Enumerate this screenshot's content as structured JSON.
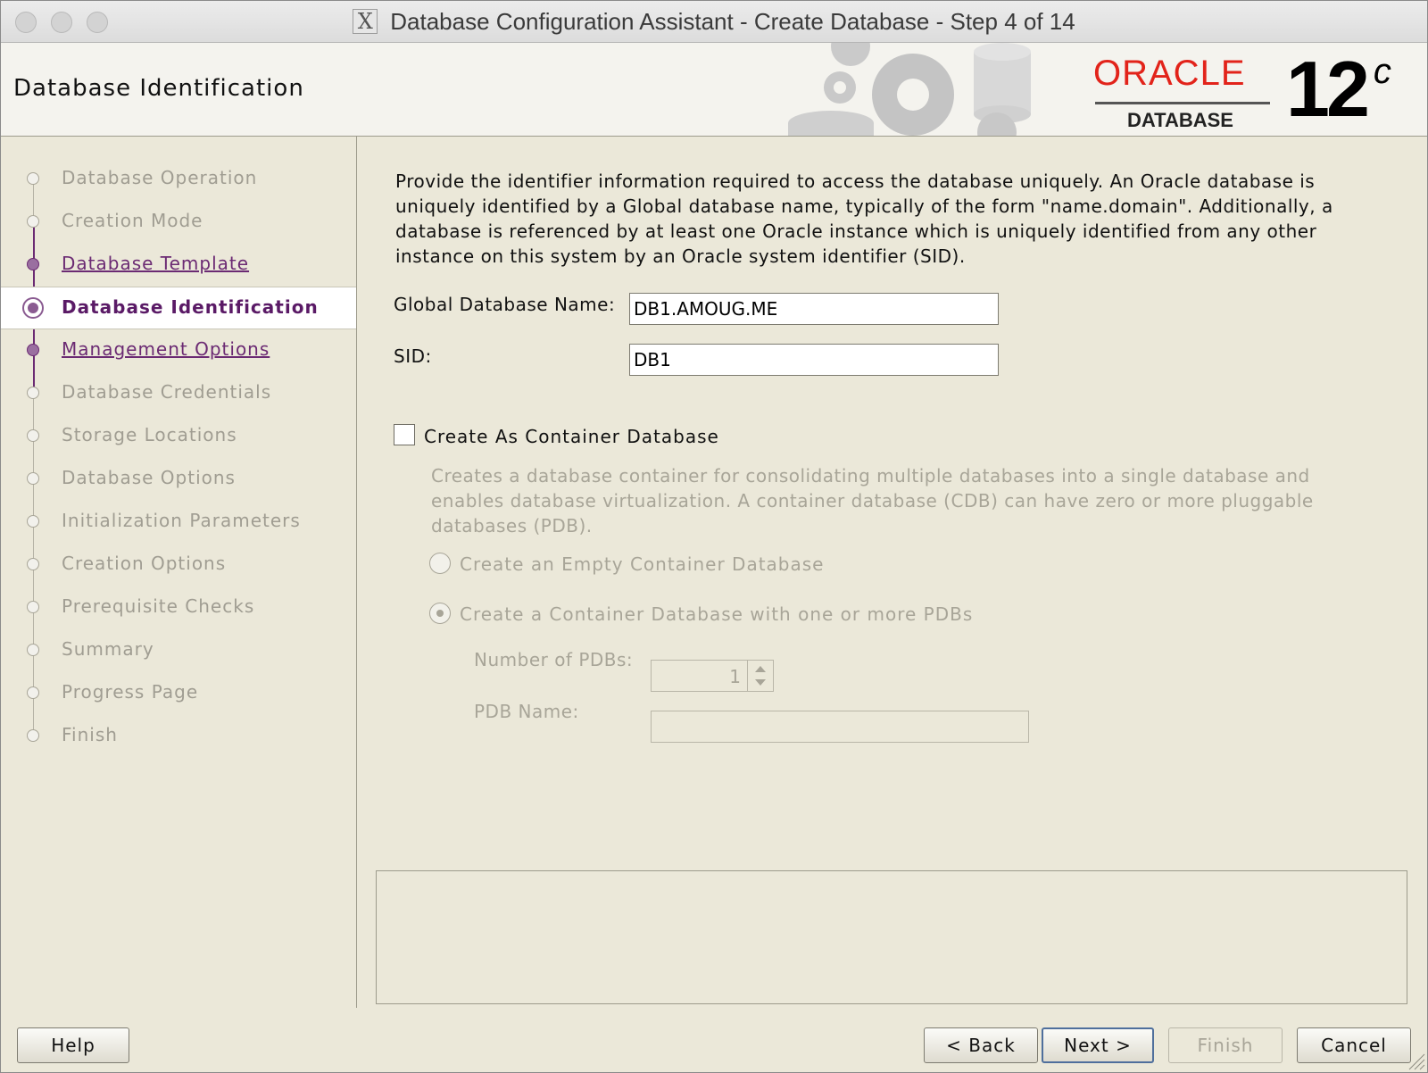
{
  "window": {
    "title": "Database Configuration Assistant - Create Database - Step 4 of 14",
    "title_icon": "X"
  },
  "banner": {
    "title": "Database Identification",
    "logo_word": "ORACLE",
    "logo_sub": "DATABASE",
    "version": "12",
    "version_sup": "c",
    "logo_color": "#e2231a"
  },
  "nav": {
    "items": [
      {
        "label": "Database Operation",
        "state": "done"
      },
      {
        "label": "Creation Mode",
        "state": "done"
      },
      {
        "label": "Database Template",
        "state": "link"
      },
      {
        "label": "Database Identification",
        "state": "current"
      },
      {
        "label": "Management Options",
        "state": "link"
      },
      {
        "label": "Database Credentials",
        "state": "pending"
      },
      {
        "label": "Storage Locations",
        "state": "pending"
      },
      {
        "label": "Database Options",
        "state": "pending"
      },
      {
        "label": "Initialization Parameters",
        "state": "pending"
      },
      {
        "label": "Creation Options",
        "state": "pending"
      },
      {
        "label": "Prerequisite Checks",
        "state": "pending"
      },
      {
        "label": "Summary",
        "state": "pending"
      },
      {
        "label": "Progress Page",
        "state": "pending"
      },
      {
        "label": "Finish",
        "state": "pending"
      }
    ]
  },
  "main": {
    "intro": "Provide the identifier information required to access the database uniquely. An Oracle database is uniquely identified by a Global database name, typically of the form \"name.domain\". Additionally, a database is referenced by at least one Oracle instance which is uniquely identified from any other instance on this system by an Oracle system identifier (SID).",
    "global_name_label": "Global Database Name:",
    "global_name_value": "DB1.AMOUG.ME",
    "sid_label": "SID:",
    "sid_value": "DB1",
    "container_checkbox_label": "Create As Container Database",
    "container_checked": false,
    "container_desc": "Creates a database container for consolidating multiple databases into a single database and enables database virtualization. A container database (CDB) can have zero or more pluggable databases (PDB).",
    "radio_empty_label": "Create an Empty Container Database",
    "radio_pdbs_label": "Create a Container Database with one or more PDBs",
    "radio_selected": "pdbs",
    "num_pdbs_label": "Number of PDBs:",
    "num_pdbs_value": "1",
    "pdb_name_label": "PDB Name:",
    "pdb_name_value": ""
  },
  "buttons": {
    "help": "Help",
    "back": "< Back",
    "next": "Next >",
    "finish": "Finish",
    "cancel": "Cancel"
  }
}
